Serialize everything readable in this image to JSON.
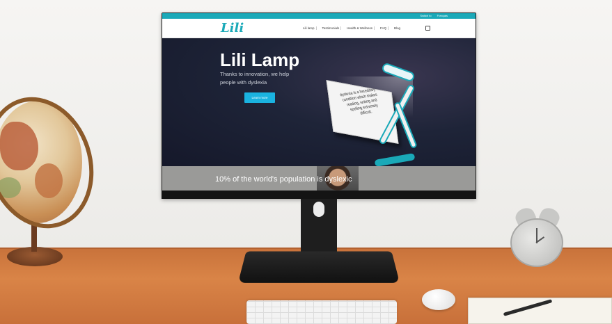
{
  "website": {
    "topbar": {
      "links": [
        "Switch to",
        "Français"
      ]
    },
    "logo": "Lili",
    "nav": [
      "Lili lamp",
      "Testimonials",
      "Health & Wellness",
      "FAQ",
      "Blog"
    ],
    "hero": {
      "title": "Lili Lamp",
      "subtitle": "Thanks to innovation, we help people with dyslexia",
      "button": "Learn more"
    },
    "book_text": "dyslexia is a hereditary condition which makes reading, writing and spelling extremely difficult.",
    "strip_text": "10% of the world's population is dyslexic"
  },
  "colors": {
    "accent": "#1aa9b8",
    "button": "#1ab3e0",
    "hero_bg": "#1e2438"
  }
}
